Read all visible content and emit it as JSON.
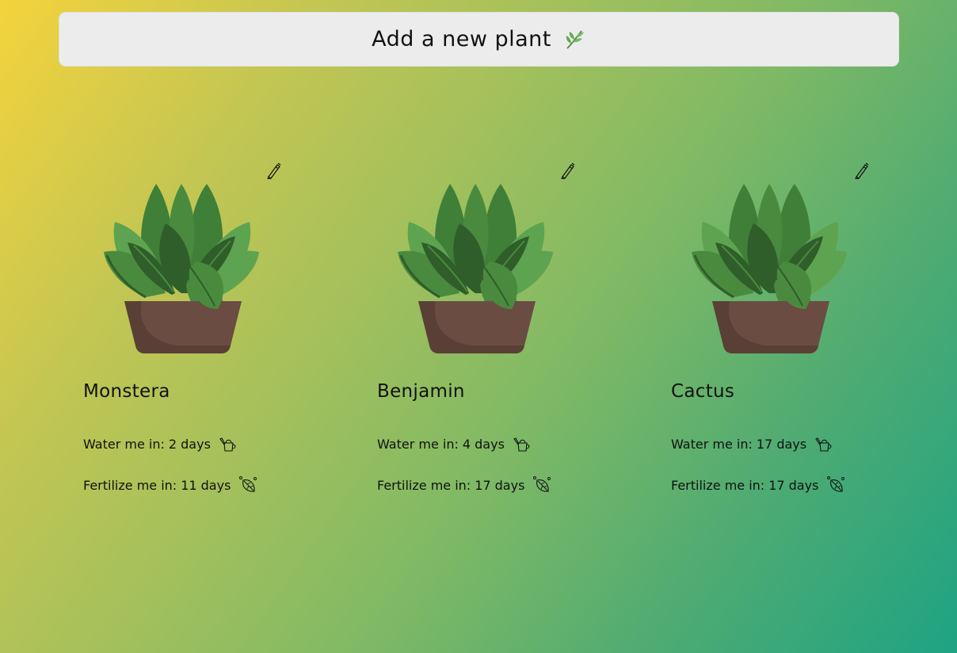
{
  "header": {
    "add_label": "Add a new plant",
    "add_icon": "herb-icon"
  },
  "plants": [
    {
      "name": "Monstera",
      "water_label": "Water me in:",
      "water_days": "2 days",
      "fertilize_label": "Fertilize me in:",
      "fertilize_days": "11 days"
    },
    {
      "name": "Benjamin",
      "water_label": "Water me in:",
      "water_days": "4 days",
      "fertilize_label": "Fertilize me in:",
      "fertilize_days": "17 days"
    },
    {
      "name": "Cactus",
      "water_label": "Water me in:",
      "water_days": "17 days",
      "fertilize_label": "Fertilize me in:",
      "fertilize_days": "17 days"
    }
  ],
  "icons": {
    "edit": "pencil-icon",
    "water": "watering-can-icon",
    "fertilize": "leaf-icon",
    "plant": "potted-plant-illustration"
  },
  "colors": {
    "background_start": "#f4d33c",
    "background_end": "#1ea383",
    "button_bg": "#ececec",
    "pot": "#6a4c42",
    "leaf_dark": "#2f5e2a",
    "leaf_mid": "#4a8a3e",
    "leaf_light": "#5ea34f"
  }
}
